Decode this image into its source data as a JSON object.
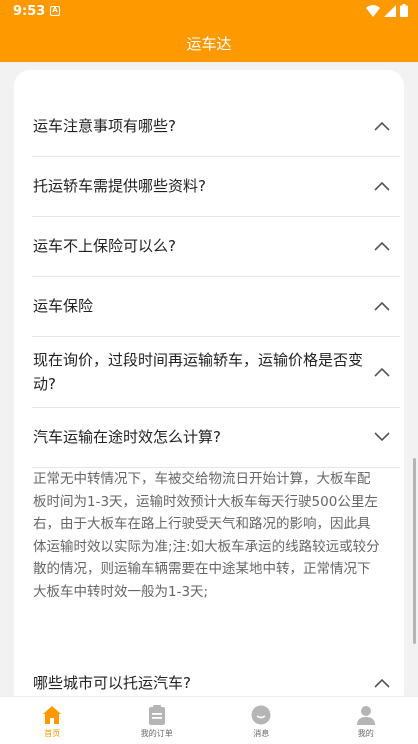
{
  "status_bar": {
    "time": "9:53",
    "notification_letter": "A"
  },
  "app_bar": {
    "title": "运车达"
  },
  "faq": {
    "items": [
      {
        "question": "运车注意事项有哪些?",
        "expanded": false
      },
      {
        "question": "托运轿车需提供哪些资料?",
        "expanded": false
      },
      {
        "question": "运车不上保险可以么?",
        "expanded": false
      },
      {
        "question": "运车保险",
        "expanded": false
      },
      {
        "question": "现在询价，过段时间再运输轿车，运输价格是否变动?",
        "expanded": false
      },
      {
        "question": "汽车运输在途时效怎么计算?",
        "expanded": true
      },
      {
        "question": "哪些城市可以托运汽车?",
        "expanded": false
      }
    ],
    "answer": "正常无中转情况下，车被交给物流日开始计算，大板车配板时间为1-3天，运输时效预计大板车每天行驶500公里左右，由于大板车在路上行驶受天气和路况的影响，因此具体运输时效以实际为准;注:如大板车承运的线路较远或较分散的情况，则运输车辆需要在中途某地中转，正常情况下大板车中转时效一般为1-3天;"
  },
  "tab_bar": {
    "tabs": [
      {
        "label": "首页",
        "icon": "home-icon",
        "active": true
      },
      {
        "label": "我的订单",
        "icon": "clipboard-icon",
        "active": false
      },
      {
        "label": "消息",
        "icon": "chat-icon",
        "active": false
      },
      {
        "label": "我的",
        "icon": "person-icon",
        "active": false
      }
    ]
  },
  "colors": {
    "accent": "#ff9900",
    "tab_inactive": "#b5b5b5"
  }
}
